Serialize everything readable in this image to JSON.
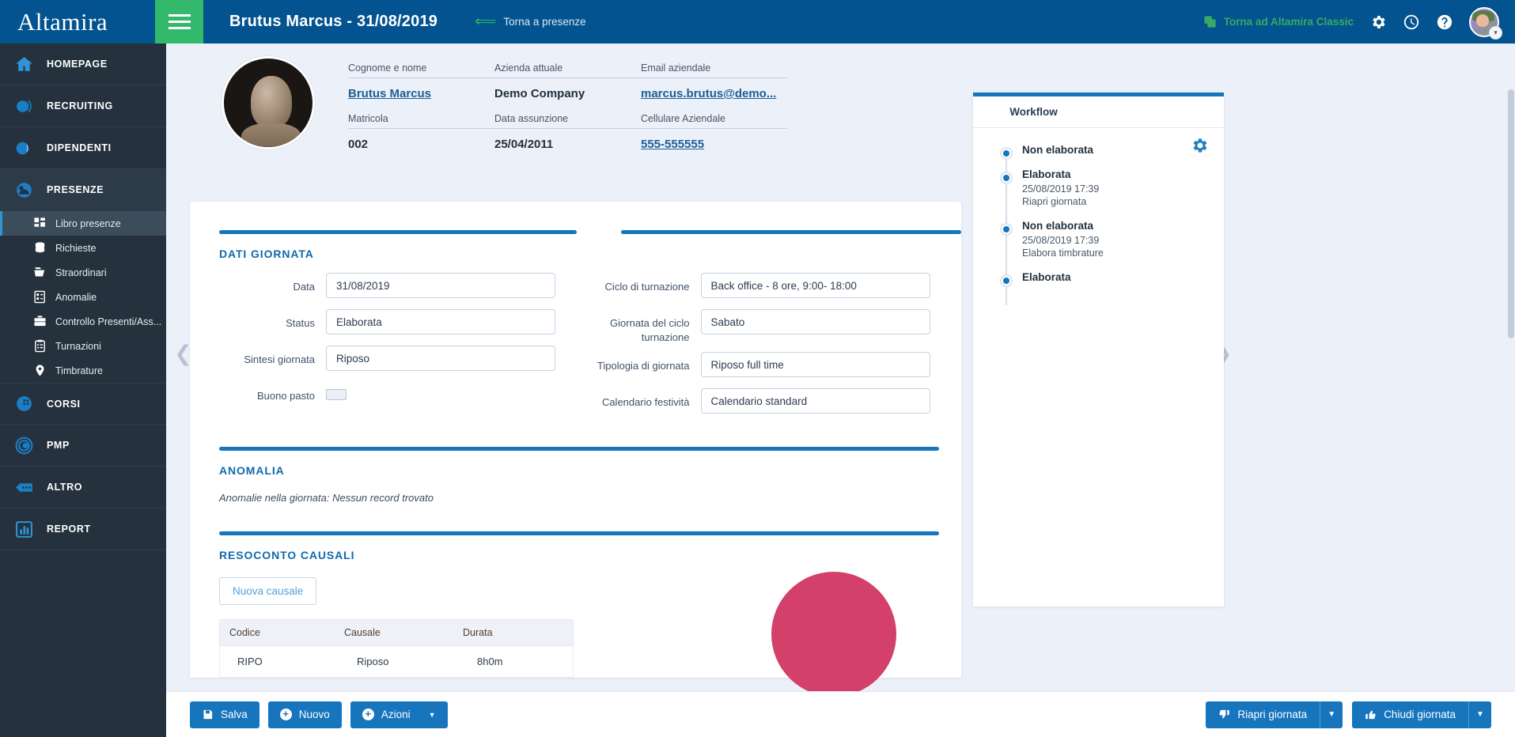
{
  "brand": {
    "name": "Altamira",
    "accent": "#02538f",
    "green": "#33b96b"
  },
  "topbar": {
    "doc_title": "Brutus Marcus - 31/08/2019",
    "back_label": "Torna a presenze",
    "classic_label": "Torna ad Altamira Classic"
  },
  "sidebar": {
    "main_items": [
      {
        "label": "HOMEPAGE",
        "icon": "home-icon"
      },
      {
        "label": "RECRUITING",
        "icon": "recruiting-icon"
      },
      {
        "label": "DIPENDENTI",
        "icon": "employees-icon"
      },
      {
        "label": "PRESENZE",
        "icon": "attendance-icon"
      },
      {
        "label": "CORSI",
        "icon": "courses-icon"
      },
      {
        "label": "PMP",
        "icon": "pmp-icon"
      },
      {
        "label": "ALTRO",
        "icon": "other-icon"
      },
      {
        "label": "REPORT",
        "icon": "report-icon"
      }
    ],
    "sub_items": [
      {
        "label": "Libro presenze",
        "icon": "grid-icon",
        "selected": true
      },
      {
        "label": "Richieste",
        "icon": "database-icon",
        "selected": false
      },
      {
        "label": "Straordinari",
        "icon": "folder-icon",
        "selected": false
      },
      {
        "label": "Anomalie",
        "icon": "document-icon",
        "selected": false
      },
      {
        "label": "Controllo Presenti/Ass...",
        "icon": "briefcase-icon",
        "selected": false
      },
      {
        "label": "Turnazioni",
        "icon": "clipboard-icon",
        "selected": false
      },
      {
        "label": "Timbrature",
        "icon": "pin-icon",
        "selected": false
      }
    ]
  },
  "profile": {
    "fields": [
      {
        "label": "Cognome e nome",
        "value": "Brutus Marcus",
        "link": true
      },
      {
        "label": "Azienda attuale",
        "value": "Demo Company",
        "link": false
      },
      {
        "label": "Email aziendale",
        "value": "marcus.brutus@demo...",
        "link": true
      },
      {
        "label": "Matricola",
        "value": "002",
        "link": false
      },
      {
        "label": "Data assunzione",
        "value": "25/04/2011",
        "link": false
      },
      {
        "label": "Cellulare Aziendale",
        "value": "555-555555",
        "link": true
      }
    ]
  },
  "sections": {
    "dati_giornata": {
      "title": "DATI GIORNATA",
      "left_rows": [
        {
          "label": "Data",
          "value": "31/08/2019",
          "type": "text"
        },
        {
          "label": "Status",
          "value": "Elaborata",
          "type": "text"
        },
        {
          "label": "Sintesi giornata",
          "value": "Riposo",
          "type": "text"
        },
        {
          "label": "Buono pasto",
          "value": "",
          "type": "checkbox"
        }
      ],
      "right_rows": [
        {
          "label": "Ciclo di turnazione",
          "value": "Back office - 8 ore, 9:00- 18:00",
          "type": "text"
        },
        {
          "label": "Giornata del ciclo turnazione",
          "value": "Sabato",
          "type": "text"
        },
        {
          "label": "Tipologia di giornata",
          "value": "Riposo full time",
          "type": "text"
        },
        {
          "label": "Calendario festività",
          "value": "Calendario standard",
          "type": "text"
        }
      ]
    },
    "anomalia": {
      "title": "ANOMALIA",
      "text": "Anomalie nella giornata: Nessun record trovato"
    },
    "resoconto": {
      "title": "RESOCONTO CAUSALI",
      "new_button": "Nuova causale",
      "columns": [
        "Codice",
        "Causale",
        "Durata"
      ],
      "rows": [
        {
          "codice": "RIPO",
          "causale": "Riposo",
          "durata": "8h0m"
        }
      ]
    }
  },
  "workflow": {
    "tab_label": "Workflow",
    "steps": [
      {
        "status": "Non elaborata",
        "time": "",
        "action": ""
      },
      {
        "status": "Elaborata",
        "time": "25/08/2019 17:39",
        "action": "Riapri giornata"
      },
      {
        "status": "Non elaborata",
        "time": "25/08/2019 17:39",
        "action": "Elabora timbrature"
      },
      {
        "status": "Elaborata",
        "time": "",
        "action": ""
      }
    ]
  },
  "bottombar": {
    "save_label": "Salva",
    "new_label": "Nuovo",
    "actions_label": "Azioni",
    "reopen_label": "Riapri giornata",
    "close_label": "Chiudi giornata"
  }
}
